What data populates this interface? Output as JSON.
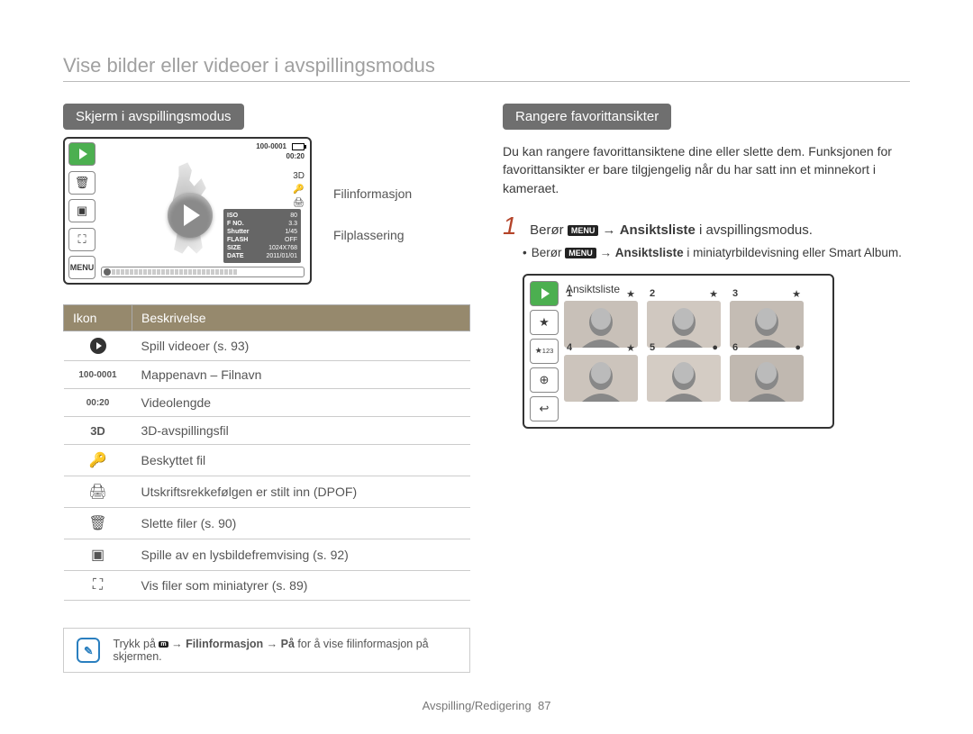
{
  "page": {
    "title": "Vise bilder eller videoer i avspillingsmodus",
    "footer_section": "Avspilling/Redigering",
    "footer_page": "87"
  },
  "left": {
    "heading": "Skjerm i avspillingsmodus",
    "screen": {
      "file_label": "100-0001",
      "duration": "00:20",
      "menu_label": "MENU",
      "info": {
        "iso_k": "ISO",
        "iso_v": "80",
        "fno_k": "F NO.",
        "fno_v": "3.3",
        "shut_k": "Shutter",
        "shut_v": "1/45",
        "flash_k": "FLASH",
        "flash_v": "OFF",
        "size_k": "SIZE",
        "size_v": "1024X768",
        "date_k": "DATE",
        "date_v": "2011/01/01"
      }
    },
    "callout_fileinfo": "Filinformasjon",
    "callout_filepos": "Filplassering",
    "table": {
      "head_icon": "Ikon",
      "head_desc": "Beskrivelse",
      "rows": [
        {
          "icon": "▶",
          "desc": "Spill videoer (s. 93)"
        },
        {
          "icon": "100-0001",
          "desc": "Mappenavn – Filnavn"
        },
        {
          "icon": "00:20",
          "desc": "Videolengde"
        },
        {
          "icon": "3D",
          "desc": "3D-avspillingsfil"
        },
        {
          "icon": "🔑",
          "desc": "Beskyttet fil"
        },
        {
          "icon": "🖨",
          "desc": "Utskriftsrekkefølgen er stilt inn (DPOF)"
        },
        {
          "icon": "🗑",
          "desc": "Slette filer (s. 90)"
        },
        {
          "icon": "▣",
          "desc": "Spille av en lysbildefremvising (s. 92)"
        },
        {
          "icon": "⛶",
          "desc": "Vis filer som miniatyrer (s. 89)"
        }
      ]
    },
    "tip": {
      "pre": "Trykk på ",
      "menu": "m",
      "mid": " → ",
      "b1": "Filinformasjon",
      "mid2": " → ",
      "b2": "På",
      "post": " for å vise filinformasjon på skjermen."
    }
  },
  "right": {
    "heading": "Rangere favorittansikter",
    "para": "Du kan rangere favorittansiktene dine eller slette dem. Funksjonen for favorittansikter er bare tilgjengelig når du har satt inn et minnekort i kameraet.",
    "step": {
      "num": "1",
      "pre": "Berør ",
      "menu": "MENU",
      "arrow": " → ",
      "bold": "Ansiktsliste",
      "post": " i avspillingsmodus."
    },
    "sub": {
      "pre": "Berør ",
      "menu": "MENU",
      "arrow": " → ",
      "bold": "Ansiktsliste",
      "post": " i miniatyrbildevisning eller Smart Album."
    },
    "grid": {
      "title": "Ansiktsliste",
      "faces": [
        {
          "n": "1",
          "star": "★"
        },
        {
          "n": "2",
          "star": "★"
        },
        {
          "n": "3",
          "star": "★"
        },
        {
          "n": "4",
          "star": "★"
        },
        {
          "n": "5",
          "star": "●"
        },
        {
          "n": "6",
          "star": "●"
        }
      ],
      "side": {
        "rank_icon": "★",
        "rank123": "123",
        "globe": "⊕",
        "back": "↩"
      }
    }
  }
}
